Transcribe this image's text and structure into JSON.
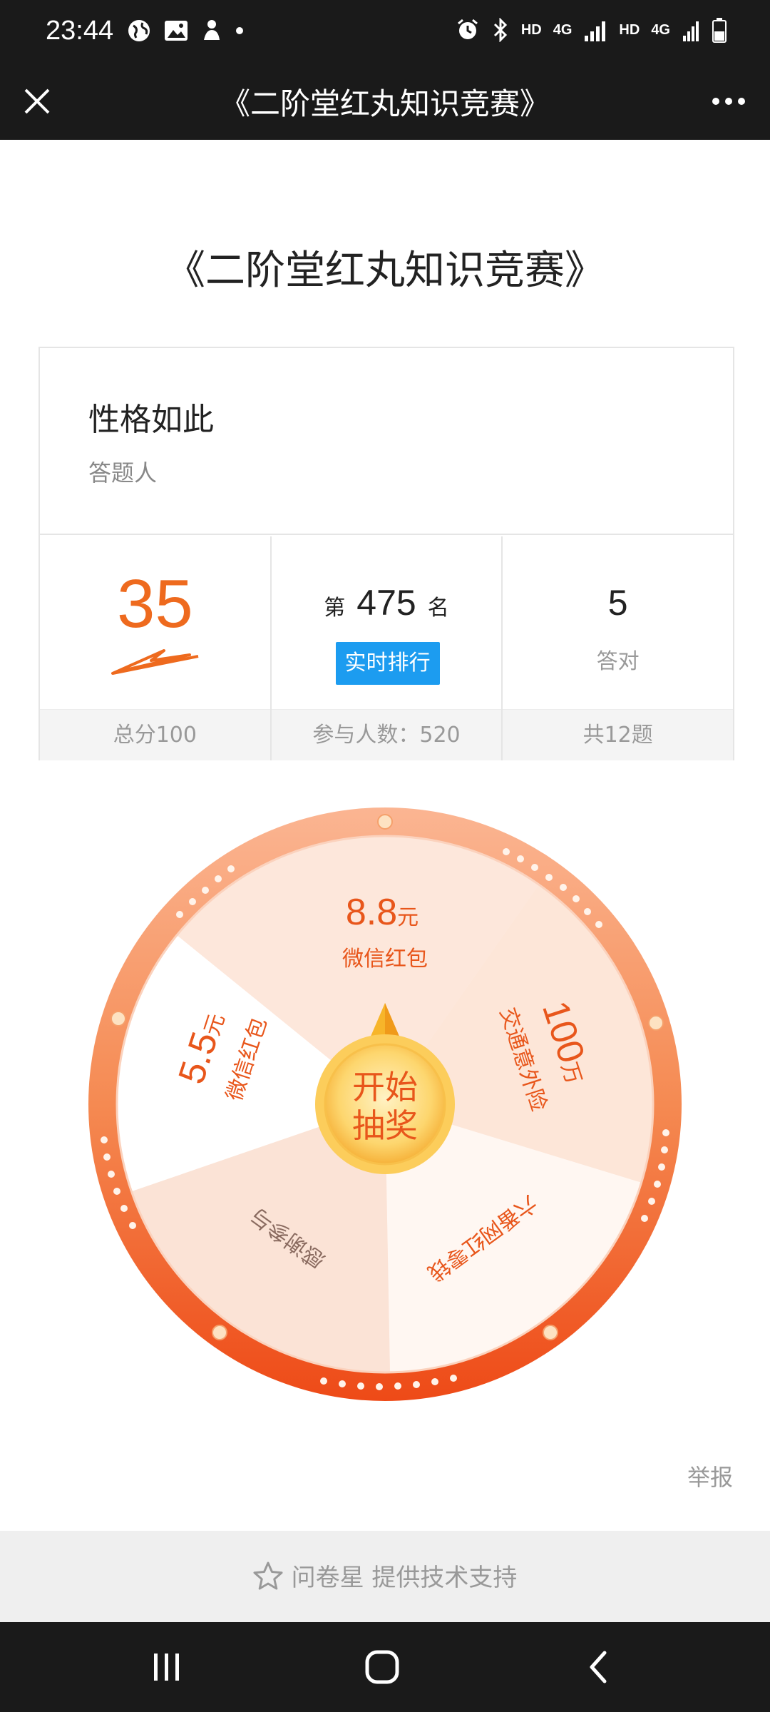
{
  "status_bar": {
    "time": "23:44",
    "right_labels": [
      "HD",
      "4G",
      "HD",
      "4G"
    ],
    "left_icons": [
      "globe-icon",
      "image-icon",
      "app-icon",
      "dot-icon"
    ],
    "right_icons": [
      "alarm-icon",
      "bluetooth-icon",
      "signal-icon",
      "signal-icon",
      "battery-icon"
    ]
  },
  "title_bar": {
    "title": "《二阶堂红丸知识竞赛》",
    "close_icon": "close-icon",
    "more_icon": "more-icon"
  },
  "quiz": {
    "title": "《二阶堂红丸知识竞赛》"
  },
  "result_card": {
    "user_name": "性格如此",
    "user_role": "答题人",
    "score": "35",
    "score_total": "总分100",
    "rank_prefix": "第",
    "rank": "475",
    "rank_suffix": "名",
    "rank_button": "实时排行",
    "participants": "参与人数：520",
    "correct": "5",
    "correct_label": "答对",
    "total_questions": "共12题"
  },
  "wheel": {
    "segments": [
      {
        "amount": "8.8",
        "unit": "元",
        "label": "微信红包"
      },
      {
        "amount": "100",
        "unit": "万",
        "label": "交通意外险"
      },
      {
        "amount": "",
        "unit": "",
        "label": "六番网红零钱"
      },
      {
        "amount": "",
        "unit": "",
        "label": "感谢参与"
      },
      {
        "amount": "5.5",
        "unit": "元",
        "label": "微信红包"
      }
    ],
    "start_button": "开始抽奖",
    "start_line1": "开始",
    "start_line2": "抽奖",
    "colors": {
      "rim": "#f26d2e",
      "amount": "#e8561b",
      "segment_light": "#fdeee5",
      "segment_white": "#ffffff",
      "button": "#fbc94a"
    }
  },
  "report_link": "举报",
  "support": {
    "text": "问卷星 提供技术支持",
    "icon": "star-icon"
  },
  "nav": {
    "icons": [
      "recents-icon",
      "home-icon",
      "back-icon"
    ]
  }
}
